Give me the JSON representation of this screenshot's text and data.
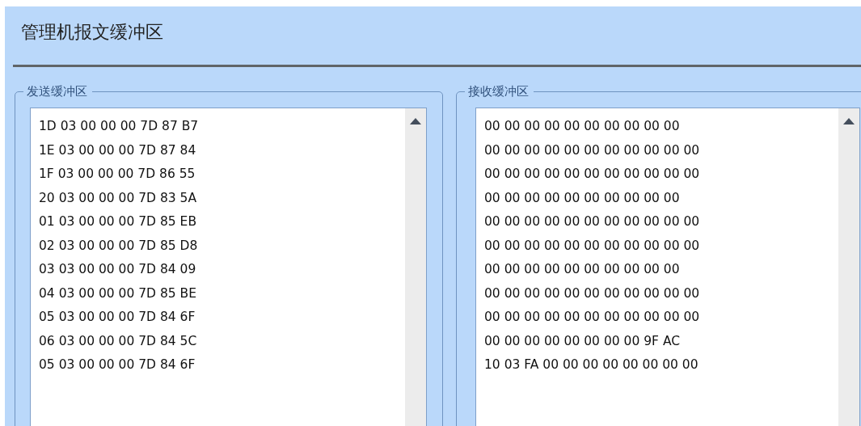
{
  "title": "管理机报文缓冲区",
  "groups": [
    {
      "label": "发送缓冲区",
      "lines": [
        "1D 03 00 00 00 7D 87 B7",
        "1E 03 00 00 00 7D 87 84",
        "1F 03 00 00 00 7D 86 55",
        "20 03 00 00 00 7D 83 5A",
        "01 03 00 00 00 7D 85 EB",
        "02 03 00 00 00 7D 85 D8",
        "03 03 00 00 00 7D 84 09",
        "04 03 00 00 00 7D 85 BE",
        "05 03 00 00 00 7D 84 6F",
        "06 03 00 00 00 7D 84 5C",
        "05 03 00 00 00 7D 84 6F"
      ]
    },
    {
      "label": "接收缓冲区",
      "lines": [
        "00 00 00 00 00 00 00 00 00 00",
        "00 00 00 00 00 00 00 00 00 00 00",
        "00 00 00 00 00 00 00 00 00 00 00",
        "00 00 00 00 00 00 00 00 00 00",
        "00 00 00 00 00 00 00 00 00 00 00",
        "00 00 00 00 00 00 00 00 00 00 00",
        "00 00 00 00 00 00 00 00 00 00",
        "00 00 00 00 00 00 00 00 00 00 00",
        "00 00 00 00 00 00 00 00 00 00 00",
        "00 00 00 00 00 00 00 00 9F AC",
        "10 03 FA 00 00 00 00 00 00 00 00"
      ]
    }
  ]
}
